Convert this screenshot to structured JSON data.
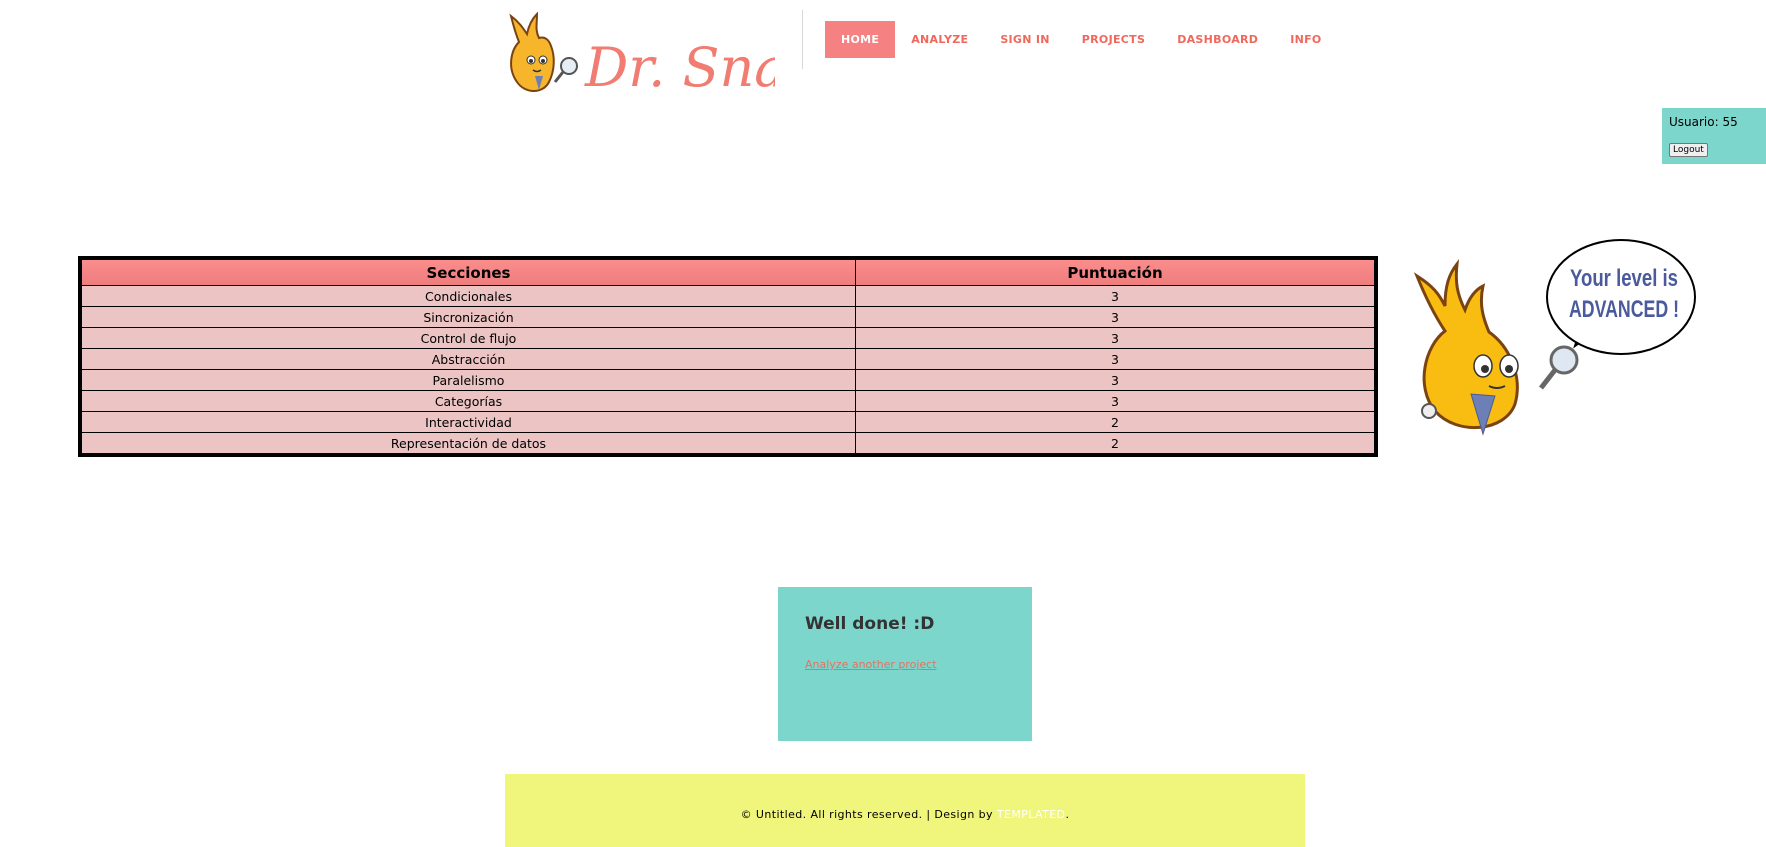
{
  "logo": {
    "text": "Dr. Snap!"
  },
  "nav": {
    "items": [
      "HOME",
      "ANALYZE",
      "SIGN IN",
      "PROJECTS",
      "DASHBOARD",
      "INFO"
    ],
    "active_index": 0
  },
  "user_box": {
    "label": "Usuario: 55",
    "logout_label": "Logout"
  },
  "table": {
    "headers": [
      "Secciones",
      "Puntuación"
    ],
    "rows": [
      [
        "Condicionales",
        "3"
      ],
      [
        "Sincronización",
        "3"
      ],
      [
        "Control de flujo",
        "3"
      ],
      [
        "Abstracción",
        "3"
      ],
      [
        "Paralelismo",
        "3"
      ],
      [
        "Categorías",
        "3"
      ],
      [
        "Interactividad",
        "2"
      ],
      [
        "Representación de datos",
        "2"
      ]
    ]
  },
  "mascot": {
    "speech": [
      "Your level is",
      "ADVANCED !"
    ]
  },
  "result": {
    "title": "Well done! :D",
    "link": "Analyze another project"
  },
  "footer": {
    "text": "© Untitled. All rights reserved. | Design by ",
    "link": "TEMPLATED",
    "suffix": "."
  },
  "colors": {
    "accent": "#f58182",
    "nav_text": "#f0675c",
    "teal": "#7dd6cb",
    "footer_bg": "#f0f57b",
    "row_bg": "#ecc4c4"
  }
}
